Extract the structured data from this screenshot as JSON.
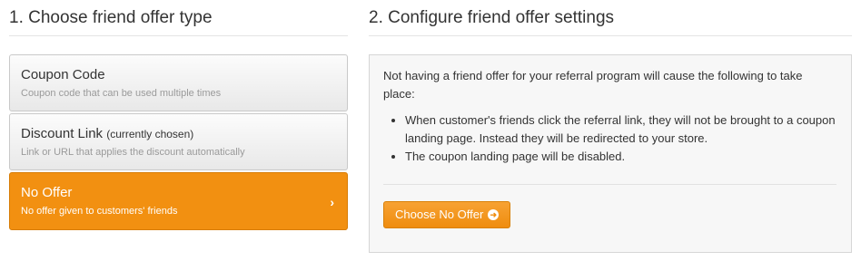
{
  "left": {
    "title": "1. Choose friend offer type",
    "options": [
      {
        "title": "Coupon Code",
        "note": "",
        "sub": "Coupon code that can be used multiple times"
      },
      {
        "title": "Discount Link",
        "note": "(currently chosen)",
        "sub": "Link or URL that applies the discount automatically"
      },
      {
        "title": "No Offer",
        "note": "",
        "sub": "No offer given to customers' friends",
        "chevron": "›"
      }
    ]
  },
  "right": {
    "title": "2. Configure friend offer settings",
    "intro": "Not having a friend offer for your referral program will cause the following to take place:",
    "bullets": [
      "When customer's friends click the referral link, they will not be brought to a coupon landing page. Instead they will be redirected to your store.",
      "The coupon landing page will be disabled."
    ],
    "button_label": "Choose No Offer",
    "button_icon": "arrow-right-circle-icon"
  },
  "colors": {
    "accent": "#f29011",
    "panel_bg": "#f7f7f7"
  }
}
